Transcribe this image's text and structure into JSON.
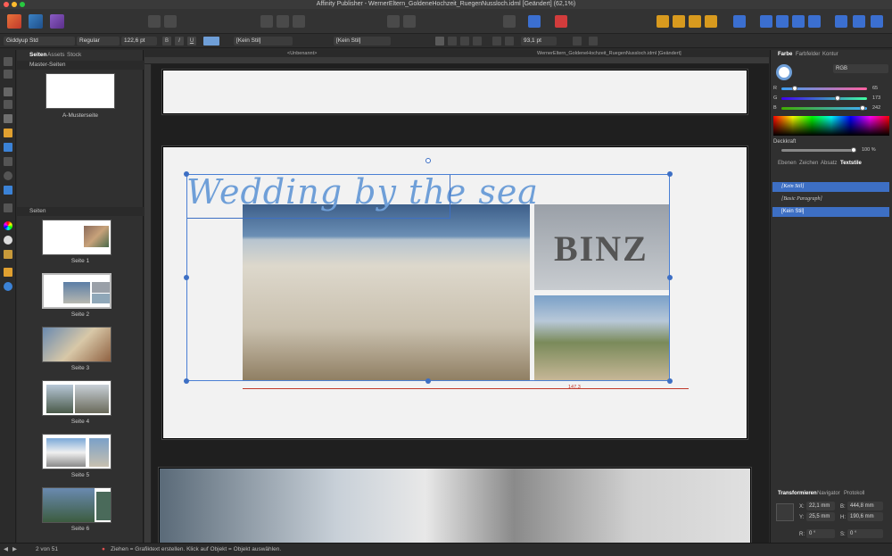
{
  "window": {
    "title": "Affinity Publisher - WernerEltern_GoldeneHochzeit_RuegenNussloch.idml [Geändert] (62,1%)"
  },
  "context_bar": {
    "font_family": "Giddyup Std",
    "font_style": "Regular",
    "font_size": "122,6 pt",
    "char_style": "[Kein Stil]",
    "para_style": "[Kein Stil]",
    "leading": "93,1 pt"
  },
  "doc_tabs": {
    "left": "<Unbenannt>",
    "right": "WernerEltern_GoldeneHochzeit_RuegenNussloch.idml [Geändert]"
  },
  "left_panel": {
    "tabs": [
      "Seiten",
      "Assets",
      "Stock"
    ],
    "master_header": "Master-Seiten",
    "master_label": "A-Musterseite",
    "pages_header": "Seiten",
    "pages": [
      "Seite 1",
      "Seite 2",
      "Seite 3",
      "Seite 4",
      "Seite 5",
      "Seite 6"
    ]
  },
  "canvas": {
    "headline": "Wedding by the sea",
    "sign_text": "BINZ",
    "dimension": "147,3"
  },
  "right_panel": {
    "color_tabs": [
      "Farbe",
      "Farbfelder",
      "Kontur"
    ],
    "color_model": "RGB",
    "r_label": "R",
    "r_value": 65,
    "g_label": "G",
    "g_value": 173,
    "b_label": "B",
    "b_value": 242,
    "opacity_label": "Deckkraft",
    "opacity_value": "100 %",
    "style_tabs": [
      "Ebenen",
      "Zeichen",
      "Absatz",
      "Textstile"
    ],
    "text_styles": [
      "[Kein Stil]",
      "[Basic Paragraph]",
      "[Kein Stil]"
    ],
    "transform_tabs": [
      "Transformieren",
      "Navigator",
      "Protokoll"
    ],
    "x_label": "X:",
    "x_value": "22,1 mm",
    "y_label": "Y:",
    "y_value": "25,5 mm",
    "w_label": "B:",
    "w_value": "444,8 mm",
    "h_label": "H:",
    "h_value": "190,6 mm",
    "r_rot_label": "R:",
    "r_rot_value": "0 °",
    "s_label": "S:",
    "s_value": "0 °"
  },
  "status": {
    "page_counter": "2 von 51",
    "hint": "Ziehen = Grafiktext erstellen. Klick auf Objekt = Objekt auswählen."
  },
  "colors": {
    "accent": "#4a7fd4",
    "headline": "#6f9fd8",
    "selection": "#3d6fc4"
  }
}
